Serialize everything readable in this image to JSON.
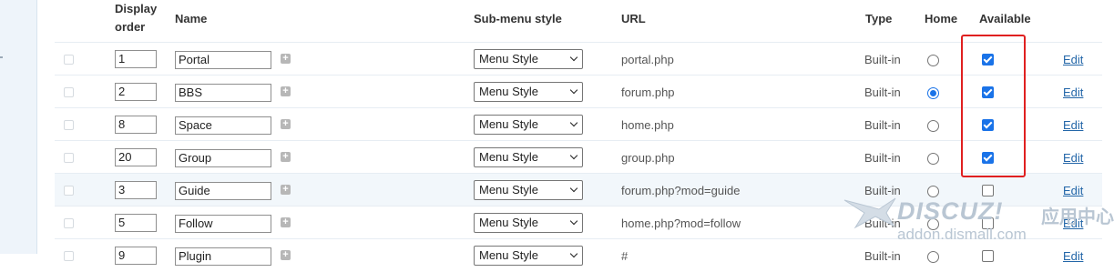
{
  "columns": {
    "display_order": "Display order",
    "display_order_l1": "Display",
    "display_order_l2": "order",
    "name": "Name",
    "submenu": "Sub-menu style",
    "url": "URL",
    "type": "Type",
    "home": "Home",
    "available": "Available"
  },
  "rows": [
    {
      "order": "1",
      "name": "Portal",
      "submenu": "Menu Style",
      "url": "portal.php",
      "type": "Built-in",
      "home": false,
      "available": true,
      "edit": "Edit"
    },
    {
      "order": "2",
      "name": "BBS",
      "submenu": "Menu Style",
      "url": "forum.php",
      "type": "Built-in",
      "home": true,
      "available": true,
      "edit": "Edit"
    },
    {
      "order": "8",
      "name": "Space",
      "submenu": "Menu Style",
      "url": "home.php",
      "type": "Built-in",
      "home": false,
      "available": true,
      "edit": "Edit"
    },
    {
      "order": "20",
      "name": "Group",
      "submenu": "Menu Style",
      "url": "group.php",
      "type": "Built-in",
      "home": false,
      "available": true,
      "edit": "Edit"
    },
    {
      "order": "3",
      "name": "Guide",
      "submenu": "Menu Style",
      "url": "forum.php?mod=guide",
      "type": "Built-in",
      "home": false,
      "available": false,
      "edit": "Edit"
    },
    {
      "order": "5",
      "name": "Follow",
      "submenu": "Menu Style",
      "url": "home.php?mod=follow",
      "type": "Built-in",
      "home": false,
      "available": false,
      "edit": "Edit"
    },
    {
      "order": "9",
      "name": "Plugin",
      "submenu": "Menu Style",
      "url": "#",
      "type": "Built-in",
      "home": false,
      "available": false,
      "edit": "Edit"
    }
  ],
  "watermark": {
    "brand": "DISCUZ!",
    "brand_cn": "应用中心",
    "url": "addon.dismall.com"
  },
  "colors": {
    "accent": "#1a73e8",
    "highlight_box": "#e02020",
    "link": "#2366a8",
    "row_highlight": "#f2f7fb"
  }
}
